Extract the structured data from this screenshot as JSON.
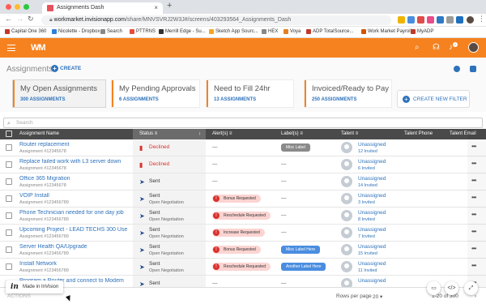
{
  "browser": {
    "tab_title": "Assignments Dash",
    "url_host": "workmarket.invisionapp.com",
    "url_path": "/share/MNVSVRJ2W3J#/screens/403293564_Assignments_Dash",
    "bookmarks": [
      "Capital One 360",
      "Nicolette - Dropbox",
      "Search",
      "PTTRNS",
      "Merrill Edge - Su...",
      "Sketch App Sourc...",
      "HEX",
      "Voya",
      "ADP TotalSource...",
      "Work Market Payroll",
      "MyADP"
    ]
  },
  "appbar": {
    "logo": "WM",
    "notification_count": "1"
  },
  "page": {
    "title": "Assignments",
    "create_label": "CREATE"
  },
  "cards": [
    {
      "title": "My Open Assignments",
      "sub": "300 ASSIGNMENTS"
    },
    {
      "title": "My Pending Approvals",
      "sub": "6 ASSIGNMENTS"
    },
    {
      "title": "Need to Fill 24hr",
      "sub": "13 ASSIGNMENTS"
    },
    {
      "title": "Invoiced/Ready to Pay",
      "sub": "250 ASSIGNMENTS"
    }
  ],
  "create_filter_label": "CREATE NEW FILTER",
  "search_placeholder": "Search",
  "columns": {
    "name": "Assignment Name",
    "status": "Status",
    "alerts": "Alert(s)",
    "labels": "Label(s)",
    "talent": "Talent",
    "phone": "Talent Phone",
    "email": "Talent Email"
  },
  "rows": [
    {
      "name": "Router replacement",
      "id": "Assignment #12345678",
      "status": "Declined",
      "status_sub": "",
      "alert": "—",
      "label": "Misc Label",
      "talent": "Unassigned",
      "invited": "12 Invited"
    },
    {
      "name": "Replace failed work with L3 server down",
      "id": "Assignment #12345678",
      "status": "Declined",
      "status_sub": "",
      "alert": "—",
      "label": "—",
      "talent": "Unassigned",
      "invited": "6 Invited"
    },
    {
      "name": "Office 365 Migration",
      "id": "Assignment #12345678",
      "status": "Sent",
      "status_sub": "",
      "alert": "—",
      "label": "—",
      "talent": "Unassigned",
      "invited": "14 Invited"
    },
    {
      "name": "VOIP Install",
      "id": "Assignment #123456789",
      "status": "Sent",
      "status_sub": "Open Negotiation",
      "alert": "Bonus Requested",
      "label": "—",
      "talent": "Unassigned",
      "invited": "3 Invited"
    },
    {
      "name": "Phone Technician needed for one day job",
      "id": "Assignment #123456789",
      "status": "Sent",
      "status_sub": "Open Negotiation",
      "alert": "Reschedule Requested",
      "label": "—",
      "talent": "Unassigned",
      "invited": "8 Invited"
    },
    {
      "name": "Upcoming Project - LEAD TECHS 300 Use Desk...",
      "id": "Assignment #123456789",
      "status": "Sent",
      "status_sub": "Open Negotiation",
      "alert": "Increase Requested",
      "label": "—",
      "talent": "Unassigned",
      "invited": "7 Invited"
    },
    {
      "name": "Server Health QA/Upgrade",
      "id": "Assignment #123456789",
      "status": "Sent",
      "status_sub": "Open Negotiation",
      "alert": "Bonus Requested",
      "label": "Misc Label Here",
      "talent": "Unassigned",
      "invited": "15 Invited"
    },
    {
      "name": "Install Network",
      "id": "Assignment #123456789",
      "status": "Sent",
      "status_sub": "Open Negotiation",
      "alert": "Reschedule Requested",
      "label": "Another Label Here",
      "talent": "Unassigned",
      "invited": "11 Invited"
    },
    {
      "name": "Program a Router and connect to Modem",
      "id": "",
      "status": "Sent",
      "status_sub": "",
      "alert": "—",
      "label": "—",
      "talent": "Unassigned",
      "invited": ""
    }
  ],
  "footer": {
    "actions": "ACTIONS",
    "rows_per_page_label": "Rows per page",
    "rows_per_page": "20",
    "range": "1-20 of 300"
  },
  "invision_badge": {
    "mark": "in",
    "text": "Made in InVision"
  },
  "colors": {
    "accent": "#f5821f",
    "link": "#2e72bb",
    "declined": "#d9322e",
    "alert_bg": "#fbd4d2"
  }
}
